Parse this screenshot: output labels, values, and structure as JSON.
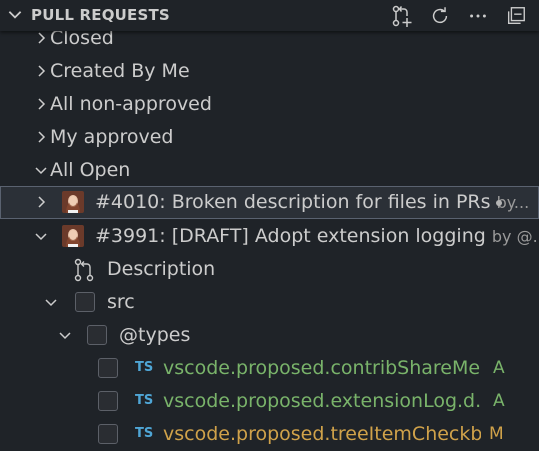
{
  "panel": {
    "title": "PULL REQUESTS",
    "actions": [
      "create-pull-request-icon",
      "refresh-icon",
      "more-icon",
      "collapse-all-icon"
    ]
  },
  "tree": {
    "categories": {
      "closed": "Closed",
      "created_by_me": "Created By Me",
      "all_non_approved": "All non-approved",
      "my_approved": "My approved",
      "all_open": "All Open"
    },
    "pr1": {
      "title": "#4010: Broken description for files in PRs",
      "author": "by...",
      "unread_icon": "dot-icon"
    },
    "pr2": {
      "title": "#3991: [DRAFT] Adopt extension logging",
      "author": "by @..."
    },
    "description_label": "Description",
    "folders": {
      "src": "src",
      "types": "@types"
    },
    "files": [
      {
        "badge": "TS",
        "name": "vscode.proposed.contribShareMen...",
        "status": "A"
      },
      {
        "badge": "TS",
        "name": "vscode.proposed.extensionLog.d.ts",
        "status": "A"
      },
      {
        "badge": "TS",
        "name": "vscode.proposed.treeItemCheckbo...",
        "status": "M"
      }
    ]
  },
  "colors": {
    "background": "#1f2328",
    "added": "#79b36a",
    "modified": "#d0a24a",
    "ts_badge": "#4fa6d6"
  }
}
